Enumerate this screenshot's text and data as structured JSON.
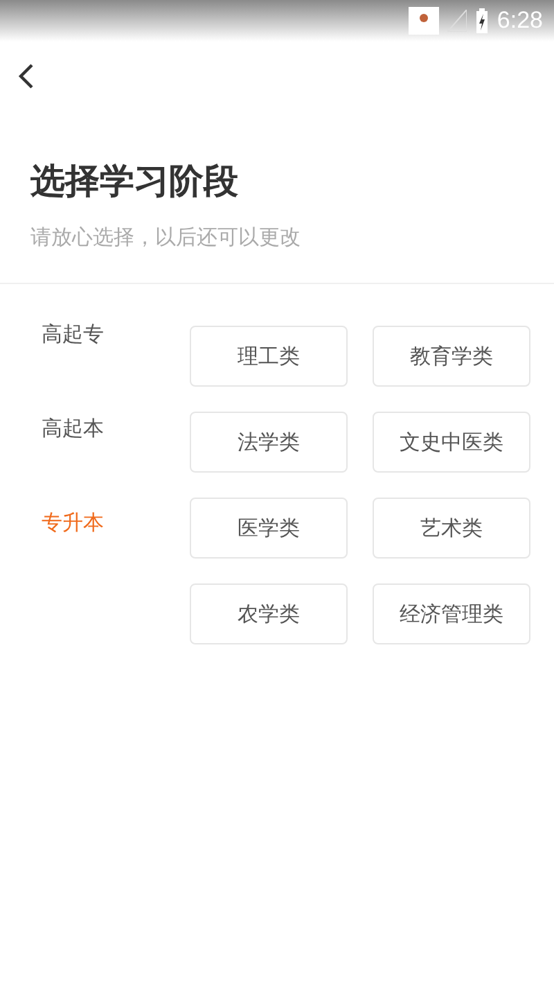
{
  "status_bar": {
    "time": "6:28"
  },
  "title": "选择学习阶段",
  "subtitle": "请放心选择，以后还可以更改",
  "levels": [
    {
      "label": "高起专",
      "selected": false
    },
    {
      "label": "高起本",
      "selected": false
    },
    {
      "label": "专升本",
      "selected": true
    }
  ],
  "categories": [
    "理工类",
    "教育学类",
    "法学类",
    "文史中医类",
    "医学类",
    "艺术类",
    "农学类",
    "经济管理类"
  ]
}
